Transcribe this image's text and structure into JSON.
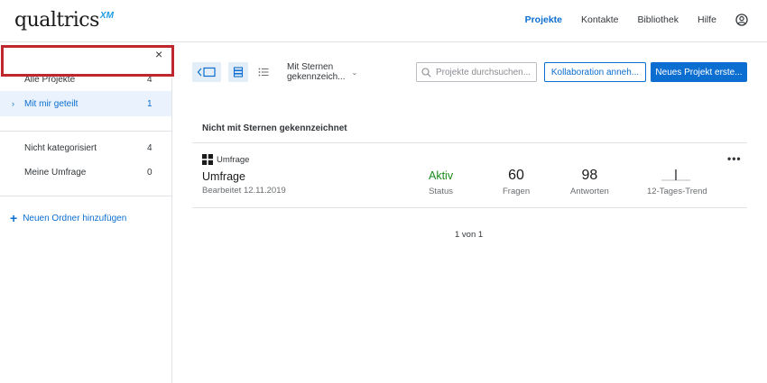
{
  "header": {
    "logo_text": "qualtrics",
    "logo_suffix": "XM",
    "nav": [
      {
        "label": "Projekte",
        "active": true
      },
      {
        "label": "Kontakte",
        "active": false
      },
      {
        "label": "Bibliothek",
        "active": false
      },
      {
        "label": "Hilfe",
        "active": false
      }
    ],
    "user_icon": "user-circle-icon"
  },
  "sidebar": {
    "close_icon": "close-icon",
    "items": [
      {
        "label": "Alle Projekte",
        "count": "4"
      },
      {
        "label": "Mit mir geteilt",
        "count": "1",
        "selected": true
      },
      {
        "label": "Nicht kategorisiert",
        "count": "4"
      },
      {
        "label": "Meine Umfrage",
        "count": "0"
      }
    ],
    "add_folder": {
      "icon": "plus-icon",
      "label": "Neuen Ordner hinzufügen"
    }
  },
  "toolbar": {
    "filter_label": "Mit Sternen gekennzeich...",
    "search_placeholder": "Projekte durchsuchen...",
    "collab_button": "Kollaboration anneh...",
    "new_project_button": "Neues Projekt erste..."
  },
  "section": {
    "title": "Nicht mit Sternen gekennzeichnet"
  },
  "project": {
    "type_label": "Umfrage",
    "name": "Umfrage",
    "edited": "Bearbeitet 12.11.2019",
    "status_value": "Aktiv",
    "status_label": "Status",
    "questions_value": "60",
    "questions_label": "Fragen",
    "responses_value": "98",
    "responses_label": "Antworten",
    "trend_label": "12-Tages-Trend",
    "more_icon": "more-icon"
  },
  "pagination": {
    "text": "1 von 1"
  },
  "colors": {
    "accent": "#0b6ed0",
    "status_active": "#1b8a1b",
    "highlight": "#c0262e"
  }
}
